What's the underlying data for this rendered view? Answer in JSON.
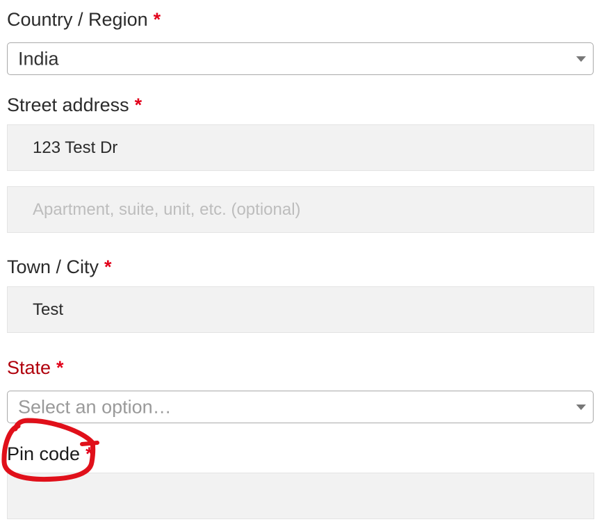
{
  "form": {
    "country": {
      "label": "Country / Region",
      "required_mark": "*",
      "value": "India"
    },
    "street": {
      "label": "Street address",
      "required_mark": "*",
      "line1_value": "123 Test Dr",
      "line2_placeholder": "Apartment, suite, unit, etc. (optional)"
    },
    "city": {
      "label": "Town / City",
      "required_mark": "*",
      "value": "Test"
    },
    "state": {
      "label": "State",
      "required_mark": "*",
      "placeholder": "Select an option…",
      "label_color": "#b0000c"
    },
    "pin": {
      "label": "Pin code",
      "required_mark": "*",
      "value": ""
    }
  },
  "colors": {
    "required": "#e2001a",
    "annotation": "#e0101a",
    "field_bg": "#f2f2f2"
  }
}
